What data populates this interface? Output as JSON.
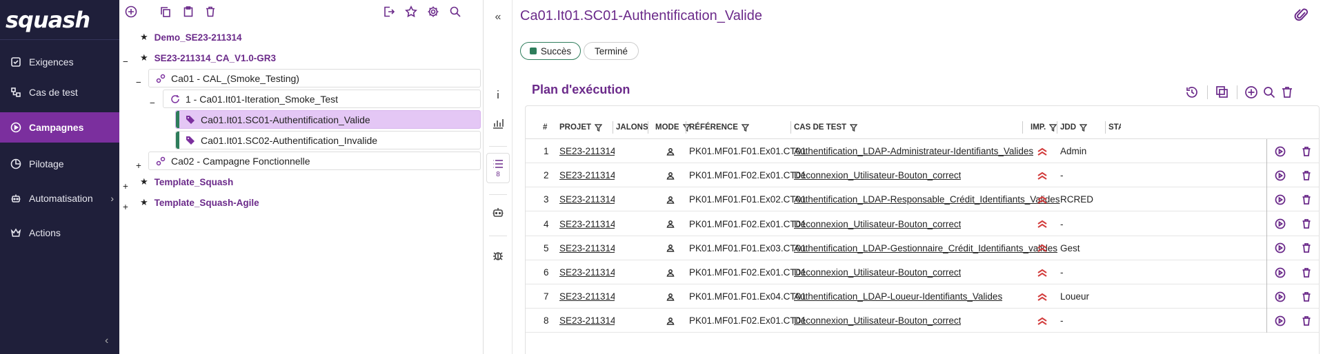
{
  "brand": {
    "logo_text": "squash"
  },
  "nav": {
    "items": [
      {
        "label": "Exigences",
        "icon": "checkbox-icon"
      },
      {
        "label": "Cas de test",
        "icon": "test-case-icon"
      },
      {
        "label": "Campagnes",
        "icon": "play-circle-icon",
        "active": true
      },
      {
        "label": "Pilotage",
        "icon": "pie-chart-icon"
      },
      {
        "label": "Automatisation",
        "icon": "robot-icon",
        "has_submenu": true
      },
      {
        "label": "Actions",
        "icon": "crown-icon"
      }
    ],
    "collapse_glyph": "‹",
    "submenu_glyph": "›"
  },
  "tree": {
    "toolbar_icons": [
      "add-icon",
      "copy-icon",
      "paste-icon",
      "delete-icon",
      "export-icon",
      "favorite-icon",
      "settings-icon",
      "search-icon"
    ],
    "nodes": [
      {
        "label": "Demo_SE23-211314",
        "type": "project"
      },
      {
        "label": "SE23-211314_CA_V1.0-GR3",
        "type": "project",
        "toggle": "−"
      },
      {
        "label": "Ca01 - CAL_(Smoke_Testing)",
        "type": "campaign",
        "toggle": "−"
      },
      {
        "label": "1 - Ca01.It01-Iteration_Smoke_Test",
        "type": "iteration",
        "toggle": "−"
      },
      {
        "label": "Ca01.It01.SC01-Authentification_Valide",
        "type": "suite",
        "selected": true
      },
      {
        "label": "Ca01.It01.SC02-Authentification_Invalide",
        "type": "suite"
      },
      {
        "label": "Ca02 - Campagne Fonctionnelle",
        "type": "campaign",
        "toggle": "+"
      },
      {
        "label": "Template_Squash",
        "type": "project",
        "toggle": "+"
      },
      {
        "label": "Template_Squash-Agile",
        "type": "project",
        "toggle": "+"
      }
    ]
  },
  "rail": {
    "plan_count": "8"
  },
  "main": {
    "title": "Ca01.It01.SC01-Authentification_Valide",
    "status_chip": "Succès",
    "state_chip": "Terminé",
    "plan_title": "Plan d'exécution",
    "columns": {
      "num": "#",
      "projet": "PROJET",
      "jalons": "JALONS",
      "mode": "MODE",
      "reference": "RÉFÉRENCE",
      "cas_de_test": "CAS DE TEST",
      "imp": "IMP.",
      "jdd": "JDD",
      "statut": "STA"
    },
    "rows": [
      {
        "num": "1",
        "projet": "SE23-211314_",
        "reference": "PK01.MF01.F01.Ex01.CT01",
        "cas": "Authentification_LDAP-Administrateur-Identifiants_Valides",
        "jdd": "Admin"
      },
      {
        "num": "2",
        "projet": "SE23-211314_",
        "reference": "PK01.MF01.F02.Ex01.CT01",
        "cas": "Déconnexion_Utilisateur-Bouton_correct",
        "jdd": "-"
      },
      {
        "num": "3",
        "projet": "SE23-211314_",
        "reference": "PK01.MF01.F01.Ex02.CT01",
        "cas": "Authentification_LDAP-Responsable_Crédit_Identifiants_Valides",
        "jdd": "RCRED"
      },
      {
        "num": "4",
        "projet": "SE23-211314_",
        "reference": "PK01.MF01.F02.Ex01.CT01",
        "cas": "Déconnexion_Utilisateur-Bouton_correct",
        "jdd": "-"
      },
      {
        "num": "5",
        "projet": "SE23-211314_",
        "reference": "PK01.MF01.F01.Ex03.CT01",
        "cas": "Authentification_LDAP-Gestionnaire_Crédit_Identifiants_valides",
        "jdd": "Gest"
      },
      {
        "num": "6",
        "projet": "SE23-211314_",
        "reference": "PK01.MF01.F02.Ex01.CT01",
        "cas": "Déconnexion_Utilisateur-Bouton_correct",
        "jdd": "-"
      },
      {
        "num": "7",
        "projet": "SE23-211314_",
        "reference": "PK01.MF01.F01.Ex04.CT01",
        "cas": "Authentification_LDAP-Loueur-Identifiants_Valides",
        "jdd": "Loueur"
      },
      {
        "num": "8",
        "projet": "SE23-211314_",
        "reference": "PK01.MF01.F02.Ex01.CT01",
        "cas": "Déconnexion_Utilisateur-Bouton_correct",
        "jdd": "-"
      }
    ]
  },
  "colors": {
    "accent": "#6b2a8a",
    "nav_bg": "#1f1f3a",
    "nav_active": "#7b2f9e",
    "success": "#2e7d5b",
    "importance": "#d23c3c",
    "selected_row": "#e4c7f5"
  }
}
